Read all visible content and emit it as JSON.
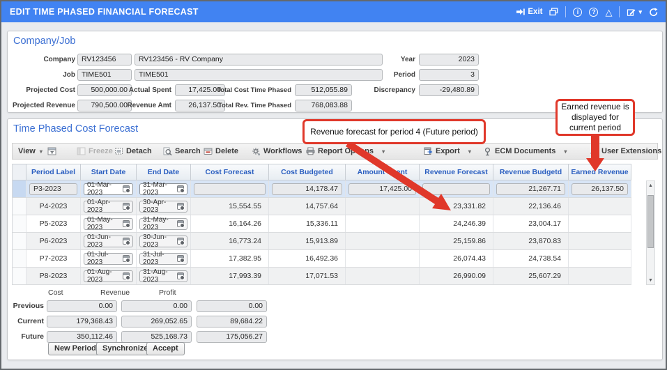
{
  "titlebar": {
    "title": "EDIT TIME PHASED FINANCIAL FORECAST",
    "exit_label": "Exit"
  },
  "icons": {
    "dropdown_caret": "▾",
    "warning_triangle": "△",
    "info_symbol": "i",
    "help_symbol": "?",
    "scroll_up": "▲",
    "scroll_down": "▼"
  },
  "company_job": {
    "heading": "Company/Job",
    "company_label": "Company",
    "company_code": "RV123456",
    "company_name": "RV123456 - RV Company",
    "job_label": "Job",
    "job_code": "TIME501",
    "job_name": "TIME501",
    "year_label": "Year",
    "year_value": "2023",
    "period_label": "Period",
    "period_value": "3",
    "projected_cost_label": "Projected Cost",
    "projected_cost": "500,000.00",
    "actual_spent_label": "Actual Spent",
    "actual_spent": "17,425.00",
    "total_cost_time_phased_label": "Total Cost Time Phased",
    "total_cost_time_phased": "512,055.89",
    "discrepancy_label": "Discrepancy",
    "discrepancy": "-29,480.89",
    "projected_revenue_label": "Projected Revenue",
    "projected_revenue": "790,500.00",
    "revenue_amt_label": "Revenue Amt",
    "revenue_amt": "26,137.50",
    "total_rev_time_phased_label": "Total Rev. Time Phased",
    "total_rev_time_phased": "768,083.88"
  },
  "forecast": {
    "heading": "Time Phased Cost Forecast",
    "toolbar": {
      "view": "View",
      "freeze": "Freeze",
      "detach": "Detach",
      "search": "Search",
      "delete": "Delete",
      "workflows": "Workflows",
      "report_options": "Report Options",
      "export": "Export",
      "ecm_documents": "ECM Documents",
      "user_extensions": "User Extensions"
    },
    "columns": [
      "Period Label",
      "Start Date",
      "End Date",
      "Cost Forecast",
      "Cost Budgeted",
      "Amount Spent",
      "Revenue Forecast",
      "Revenue Budgetd",
      "Earned Revenue"
    ],
    "rows": [
      {
        "period": "P3-2023",
        "start": "01-Mar-2023",
        "end": "31-Mar-2023",
        "cost_forecast": "",
        "cost_budgeted": "14,178.47",
        "amount_spent": "17,425.00",
        "revenue_forecast": "",
        "revenue_budgeted": "21,267.71",
        "earned_revenue": "26,137.50"
      },
      {
        "period": "P4-2023",
        "start": "01-Apr-2023",
        "end": "30-Apr-2023",
        "cost_forecast": "15,554.55",
        "cost_budgeted": "14,757.64",
        "amount_spent": "",
        "revenue_forecast": "23,331.82",
        "revenue_budgeted": "22,136.46",
        "earned_revenue": ""
      },
      {
        "period": "P5-2023",
        "start": "01-May-2023",
        "end": "31-May-2023",
        "cost_forecast": "16,164.26",
        "cost_budgeted": "15,336.11",
        "amount_spent": "",
        "revenue_forecast": "24,246.39",
        "revenue_budgeted": "23,004.17",
        "earned_revenue": ""
      },
      {
        "period": "P6-2023",
        "start": "01-Jun-2023",
        "end": "30-Jun-2023",
        "cost_forecast": "16,773.24",
        "cost_budgeted": "15,913.89",
        "amount_spent": "",
        "revenue_forecast": "25,159.86",
        "revenue_budgeted": "23,870.83",
        "earned_revenue": ""
      },
      {
        "period": "P7-2023",
        "start": "01-Jul-2023",
        "end": "31-Jul-2023",
        "cost_forecast": "17,382.95",
        "cost_budgeted": "16,492.36",
        "amount_spent": "",
        "revenue_forecast": "26,074.43",
        "revenue_budgeted": "24,738.54",
        "earned_revenue": ""
      },
      {
        "period": "P8-2023",
        "start": "01-Aug-2023",
        "end": "31-Aug-2023",
        "cost_forecast": "17,993.39",
        "cost_budgeted": "17,071.53",
        "amount_spent": "",
        "revenue_forecast": "26,990.09",
        "revenue_budgeted": "25,607.29",
        "earned_revenue": ""
      }
    ]
  },
  "summary": {
    "col_headers": [
      "Cost",
      "Revenue",
      "Profit"
    ],
    "row_labels": [
      "Previous",
      "Current",
      "Future"
    ],
    "previous": [
      "0.00",
      "0.00",
      "0.00"
    ],
    "current": [
      "179,368.43",
      "269,052.65",
      "89,684.22"
    ],
    "future": [
      "350,112.46",
      "525,168.73",
      "175,056.27"
    ],
    "buttons": [
      "New Periods",
      "Synchronize",
      "Accept"
    ]
  },
  "callouts": {
    "revenue_forecast_note": "Revenue forecast for period 4 (Future period)",
    "earned_revenue_note": "Earned revenue is displayed for current period"
  },
  "colors": {
    "titlebar_blue": "#4183f2",
    "heading_blue": "#3b6fd3",
    "header_text_blue": "#2b5fc0",
    "callout_red": "#e0382a",
    "selected_row_blue": "#d8e5f6"
  }
}
